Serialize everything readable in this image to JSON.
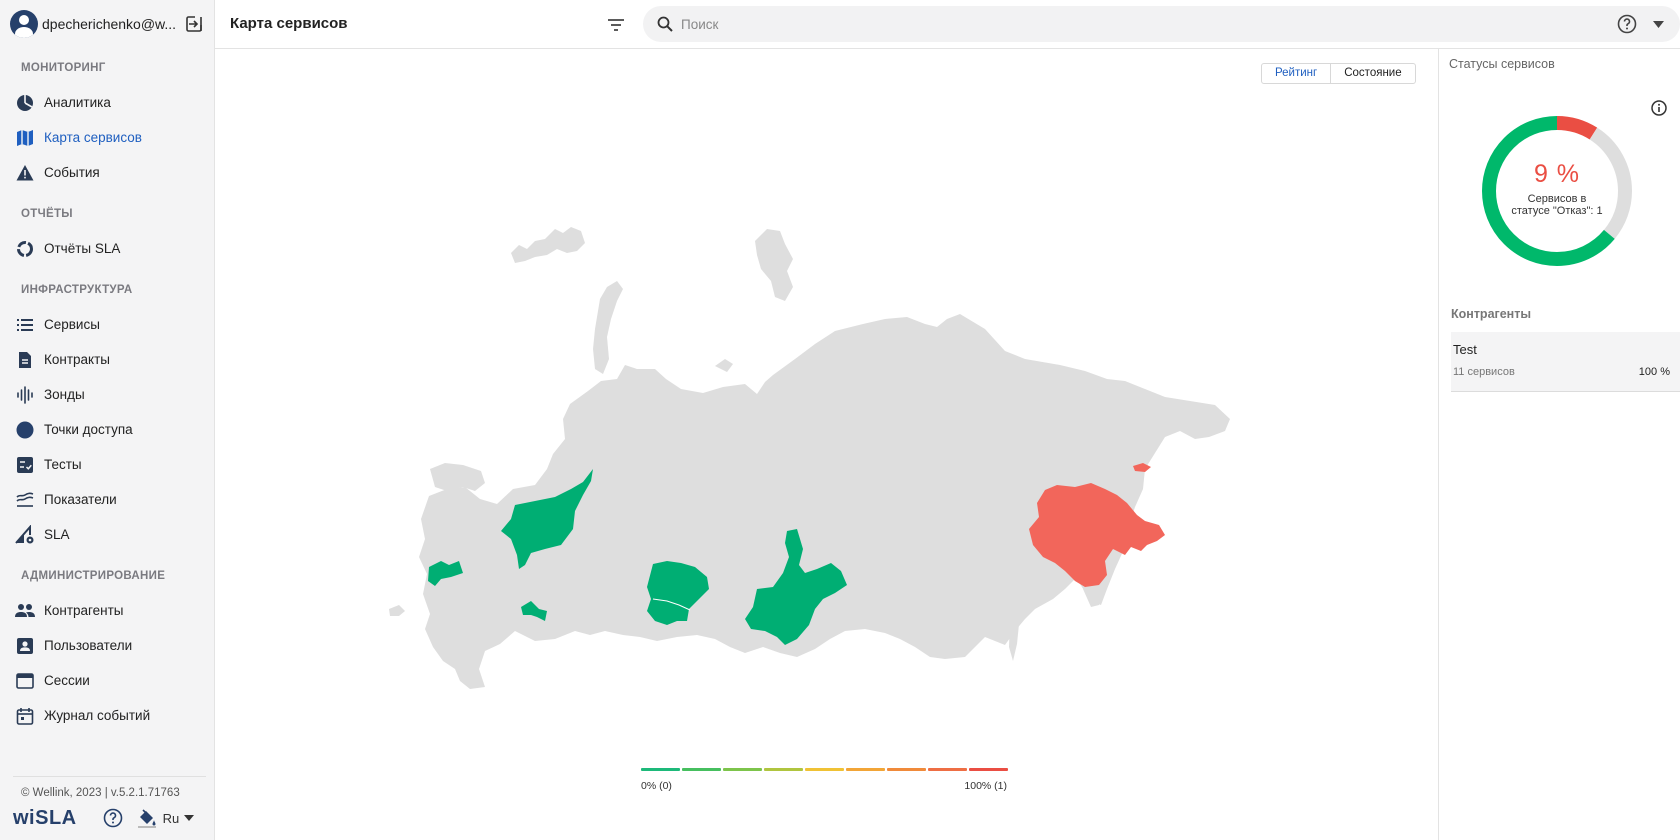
{
  "user": {
    "name": "dpecherichenko@w..."
  },
  "sidebar": {
    "sections": [
      {
        "title": "МОНИТОРИНГ",
        "items": [
          {
            "label": "Аналитика",
            "icon": "pie-chart-icon"
          },
          {
            "label": "Карта сервисов",
            "icon": "map-icon",
            "active": true
          },
          {
            "label": "События",
            "icon": "warning-icon"
          }
        ]
      },
      {
        "title": "ОТЧЁТЫ",
        "items": [
          {
            "label": "Отчёты SLA",
            "icon": "ring-chart-icon"
          }
        ]
      },
      {
        "title": "ИНФРАСТРУКТУРА",
        "items": [
          {
            "label": "Сервисы",
            "icon": "list-icon"
          },
          {
            "label": "Контракты",
            "icon": "document-icon"
          },
          {
            "label": "Зонды",
            "icon": "signal-icon"
          },
          {
            "label": "Точки доступа",
            "icon": "circle-icon"
          },
          {
            "label": "Тесты",
            "icon": "checklist-icon"
          },
          {
            "label": "Показатели",
            "icon": "metrics-icon"
          },
          {
            "label": "SLA",
            "icon": "sla-gear-icon"
          }
        ]
      },
      {
        "title": "АДМИНИСТРИРОВАНИЕ",
        "items": [
          {
            "label": "Контрагенты",
            "icon": "people-icon"
          },
          {
            "label": "Пользователи",
            "icon": "user-card-icon"
          },
          {
            "label": "Сессии",
            "icon": "window-icon"
          },
          {
            "label": "Журнал событий",
            "icon": "calendar-icon"
          }
        ]
      }
    ],
    "footer": {
      "copyright": "© Wellink, 2023 | v.5.2.1.71763",
      "logo": "wiSLA",
      "lang": "Ru"
    }
  },
  "header": {
    "title": "Карта сервисов",
    "search_placeholder": "Поиск"
  },
  "main": {
    "toggle": {
      "rating": "Рейтинг",
      "state": "Состояние"
    },
    "legend": {
      "min_label": "0% (0)",
      "max_label": "100% (1)",
      "colors": [
        "#1db97a",
        "#46bf5f",
        "#7dc44b",
        "#b0c53f",
        "#f0c235",
        "#f2a537",
        "#f08a3a",
        "#ee6e44",
        "#ea4e43"
      ]
    },
    "map": {
      "colors": {
        "base": "#dedede",
        "ok": "#00ae73",
        "fail": "#f2665b"
      }
    }
  },
  "rpanel": {
    "title": "Статусы сервисов",
    "donut": {
      "percent": "9 %",
      "label": "Сервисов в статусе \"Отказ\": 1",
      "segments": [
        {
          "name": "fail",
          "fraction": 0.09,
          "color": "#ea4e43"
        },
        {
          "name": "unknown",
          "fraction": 0.27,
          "color": "#dedede"
        },
        {
          "name": "ok",
          "fraction": 0.64,
          "color": "#00b86b"
        }
      ]
    },
    "contractors_title": "Контрагенты",
    "contractors": [
      {
        "name": "Test",
        "count": "11 сервисов",
        "percent": "100 %"
      }
    ]
  }
}
